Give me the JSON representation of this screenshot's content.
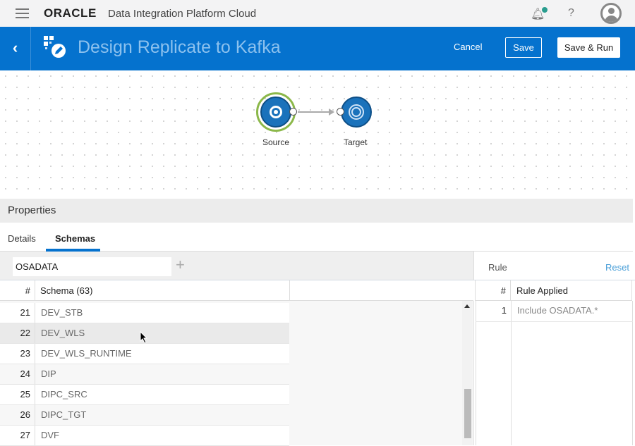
{
  "topbar": {
    "logo": "ORACLE",
    "app_title": "Data Integration Platform Cloud",
    "help": "?"
  },
  "header": {
    "title": "Design Replicate to Kafka",
    "cancel": "Cancel",
    "save": "Save",
    "save_run": "Save & Run",
    "back": "‹"
  },
  "canvas": {
    "nodes": [
      {
        "label": "Source"
      },
      {
        "label": "Target"
      }
    ]
  },
  "properties": {
    "title": "Properties",
    "tabs": [
      {
        "label": "Details",
        "active": false
      },
      {
        "label": "Schemas",
        "active": true
      }
    ]
  },
  "schemas": {
    "filter_value": "OSADATA",
    "add": "+",
    "col_num": "#",
    "col_schema": "Schema (63)",
    "rows": [
      {
        "n": "21",
        "name": "DEV_STB"
      },
      {
        "n": "22",
        "name": "DEV_WLS"
      },
      {
        "n": "23",
        "name": "DEV_WLS_RUNTIME"
      },
      {
        "n": "24",
        "name": "DIP"
      },
      {
        "n": "25",
        "name": "DIPC_SRC"
      },
      {
        "n": "26",
        "name": "DIPC_TGT"
      },
      {
        "n": "27",
        "name": "DVF"
      }
    ]
  },
  "rules": {
    "title": "Rule",
    "reset": "Reset",
    "col_num": "#",
    "col_rule": "Rule Applied",
    "rows": [
      {
        "n": "1",
        "rule": "Include OSADATA.*"
      }
    ]
  },
  "colors": {
    "brand_blue": "#0572ce",
    "tab_underline": "#0572ce",
    "source_ring": "#8cb84a"
  }
}
